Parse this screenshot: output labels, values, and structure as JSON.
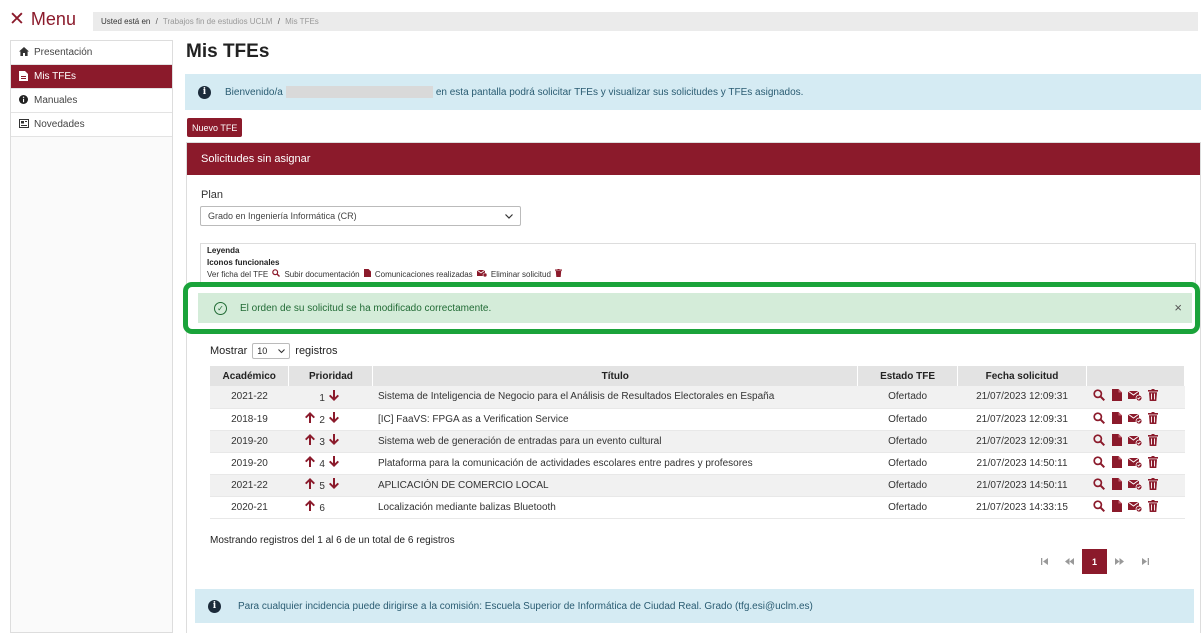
{
  "header": {
    "menu_icon": "close-icon",
    "menu_label": "Menu",
    "breadcrumb": {
      "prefix": "Usted está en",
      "items": [
        "Trabajos fin de estudios UCLM",
        "Mis TFEs"
      ]
    }
  },
  "sidebar": {
    "items": [
      {
        "label": "Presentación",
        "icon": "home-icon",
        "active": false
      },
      {
        "label": "Mis TFEs",
        "icon": "document-icon",
        "active": true
      },
      {
        "label": "Manuales",
        "icon": "info-icon",
        "active": false
      },
      {
        "label": "Novedades",
        "icon": "news-icon",
        "active": false
      }
    ]
  },
  "main": {
    "title": "Mis TFEs",
    "welcome_before": "Bienvenido/a",
    "welcome_after": "en esta pantalla podrá solicitar TFEs y visualizar sus solicitudes y TFEs asignados.",
    "new_button": "Nuevo TFE",
    "panel_title": "Solicitudes sin asignar",
    "plan_label": "Plan",
    "plan_value": "Grado en Ingeniería Informática (CR)",
    "legend": {
      "title": "Leyenda",
      "subtitle": "Iconos funcionales",
      "items": [
        "Ver ficha del TFE",
        "Subir documentación",
        "Comunicaciones realizadas",
        "Eliminar solicitud"
      ]
    },
    "success_message": "El orden de su solicitud se ha modificado correctamente.",
    "show_prefix": "Mostrar",
    "show_value": "10",
    "show_suffix": "registros",
    "table": {
      "headers": [
        "Académico",
        "Prioridad",
        "Título",
        "Estado TFE",
        "Fecha solicitud",
        ""
      ],
      "rows": [
        {
          "academico": "2021-22",
          "prioridad": "1",
          "up": false,
          "down": true,
          "titulo": "Sistema de Inteligencia de Negocio para el Análisis de Resultados Electorales en España",
          "estado": "Ofertado",
          "fecha": "21/07/2023 12:09:31"
        },
        {
          "academico": "2018-19",
          "prioridad": "2",
          "up": true,
          "down": true,
          "titulo": "[IC] FaaVS: FPGA as a Verification Service",
          "estado": "Ofertado",
          "fecha": "21/07/2023 12:09:31"
        },
        {
          "academico": "2019-20",
          "prioridad": "3",
          "up": true,
          "down": true,
          "titulo": "Sistema web de generación de entradas para un evento cultural",
          "estado": "Ofertado",
          "fecha": "21/07/2023 12:09:31"
        },
        {
          "academico": "2019-20",
          "prioridad": "4",
          "up": true,
          "down": true,
          "titulo": "Plataforma para la comunicación de actividades escolares entre padres y profesores",
          "estado": "Ofertado",
          "fecha": "21/07/2023 14:50:11"
        },
        {
          "academico": "2021-22",
          "prioridad": "5",
          "up": true,
          "down": true,
          "titulo": "APLICACIÓN DE COMERCIO LOCAL",
          "estado": "Ofertado",
          "fecha": "21/07/2023 14:50:11"
        },
        {
          "academico": "2020-21",
          "prioridad": "6",
          "up": true,
          "down": false,
          "titulo": "Localización mediante balizas Bluetooth",
          "estado": "Ofertado",
          "fecha": "21/07/2023 14:33:15"
        }
      ]
    },
    "records_info": "Mostrando registros del 1 al 6 de un total de 6 registros",
    "pagination": {
      "current": "1"
    },
    "footer_info": "Para cualquier incidencia puede dirigirse a la comisión: Escuela Superior de Informática de Ciudad Real. Grado (tfg.esi@uclm.es)"
  },
  "colors": {
    "brand": "#8b1a2b",
    "success_border": "#1aa33a",
    "info_bg": "#d5ebf3"
  }
}
